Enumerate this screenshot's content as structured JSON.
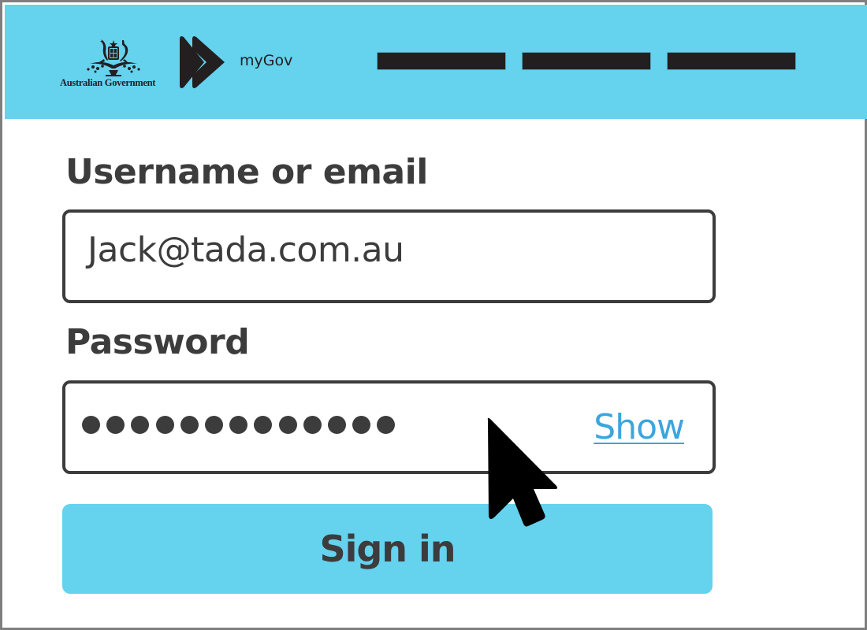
{
  "header": {
    "government_logo_text": "Australian Government",
    "government_crest_icon": "coat-of-arms-icon",
    "mygov_mark_icon": "mygov-chevron-icon",
    "mygov_text": "myGov",
    "nav_items": [
      "",
      "",
      ""
    ],
    "colors": {
      "header_bg": "#65d2ee",
      "nav_bar": "#231f20"
    }
  },
  "form": {
    "username": {
      "label": "Username or email",
      "value": "Jack@tada.com.au"
    },
    "password": {
      "label": "Password",
      "masked_length": 13,
      "mask_char": "●",
      "show_label": "Show"
    },
    "submit_label": "Sign in",
    "colors": {
      "text": "#3c3c3c",
      "link": "#3aa6dd",
      "button_bg": "#65d2ee"
    }
  },
  "pointer": {
    "icon": "mouse-pointer-icon"
  }
}
